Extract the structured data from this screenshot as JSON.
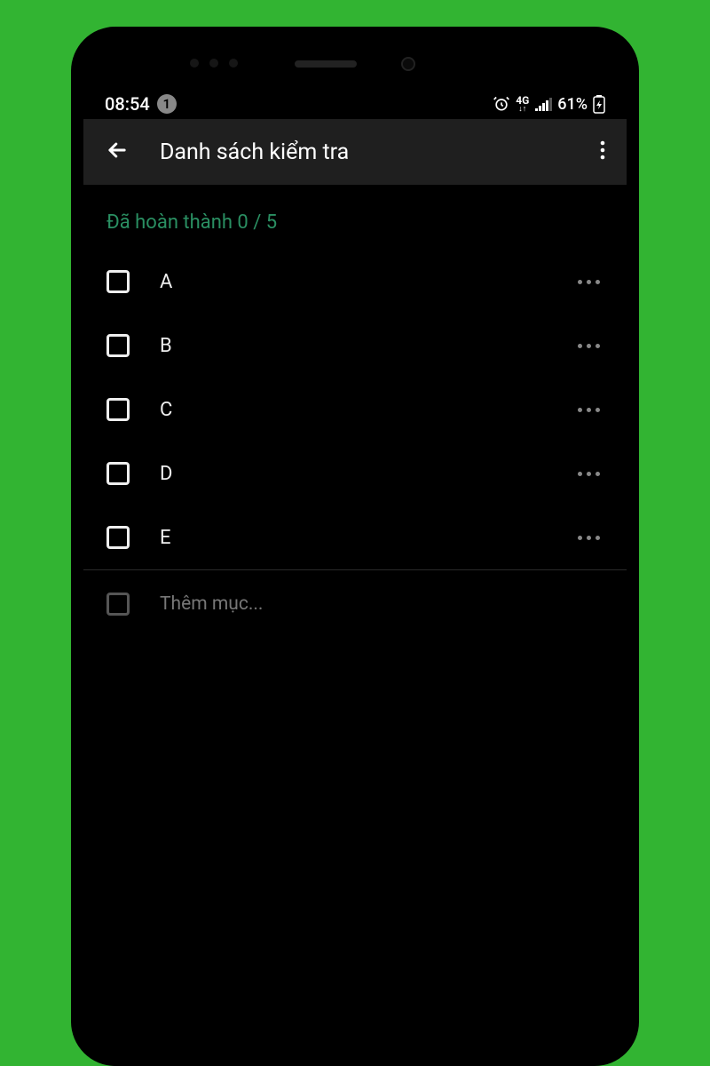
{
  "status": {
    "time": "08:54",
    "notif_count": "1",
    "network_label": "4G",
    "battery_text": "61%"
  },
  "header": {
    "title": "Danh sách kiểm tra"
  },
  "progress": {
    "text": "Đã hoàn thành 0 / 5"
  },
  "items": [
    {
      "label": "A"
    },
    {
      "label": "B"
    },
    {
      "label": "C"
    },
    {
      "label": "D"
    },
    {
      "label": "E"
    }
  ],
  "add": {
    "placeholder": "Thêm mục..."
  }
}
